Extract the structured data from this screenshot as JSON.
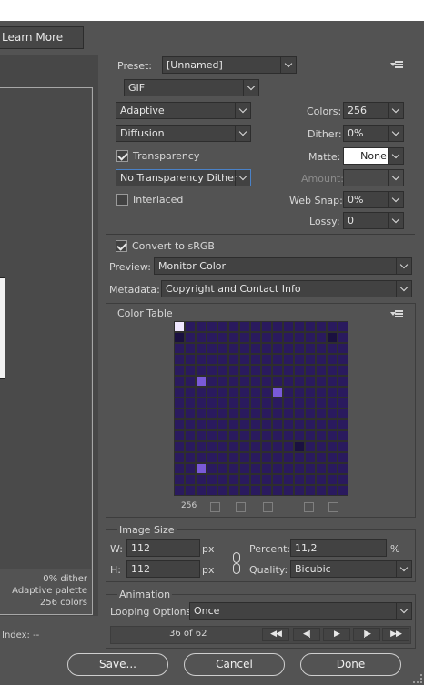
{
  "header": {
    "learn_more": "Learn More"
  },
  "preview_info": {
    "dither": "0% dither",
    "palette": "Adaptive palette",
    "colors": "256 colors",
    "index": "Index: --"
  },
  "settings": {
    "preset_label": "Preset:",
    "preset_value": "[Unnamed]",
    "format": "GIF",
    "reduction": "Adaptive",
    "dither_algo": "Diffusion",
    "transparency_label": "Transparency",
    "transparency_checked": true,
    "trans_dither": "No Transparency Dither",
    "interlaced_label": "Interlaced",
    "interlaced_checked": false,
    "colors_label": "Colors:",
    "colors_value": "256",
    "dither_label": "Dither:",
    "dither_value": "0%",
    "matte_label": "Matte:",
    "matte_value": "None",
    "amount_label": "Amount:",
    "amount_value": "",
    "websnap_label": "Web Snap:",
    "websnap_value": "0%",
    "lossy_label": "Lossy:",
    "lossy_value": "0",
    "convert_label": "Convert to sRGB",
    "convert_checked": true,
    "preview_label": "Preview:",
    "preview_value": "Monitor Color",
    "metadata_label": "Metadata:",
    "metadata_value": "Copyright and Contact Info"
  },
  "color_table": {
    "title": "Color Table",
    "count": "256",
    "palette": [
      "#2a1a5e",
      "#8f6be0",
      "#4a2aa8",
      "#c9b7f0",
      "#f0e8ff",
      "#6b4bcf",
      "#3a2a80",
      "#b09ae8",
      "#1a1040",
      "#7a5ad8",
      "#e8d8ff",
      "#5a3ac0",
      "#9a82e0",
      "#f5f0d8",
      "#3e2e6e",
      "#a88ae8"
    ]
  },
  "image_size": {
    "title": "Image Size",
    "w_label": "W:",
    "w_value": "112",
    "h_label": "H:",
    "h_value": "112",
    "unit": "px",
    "percent_label": "Percent:",
    "percent_value": "11,2",
    "percent_unit": "%",
    "quality_label": "Quality:",
    "quality_value": "Bicubic"
  },
  "animation": {
    "title": "Animation",
    "looping_label": "Looping Options:",
    "looping_value": "Once",
    "frame": "36 of 62",
    "nav": [
      "◀◀",
      "◀|",
      "▶",
      "|▶",
      "▶▶"
    ]
  },
  "buttons": {
    "save": "Save...",
    "cancel": "Cancel",
    "done": "Done"
  }
}
